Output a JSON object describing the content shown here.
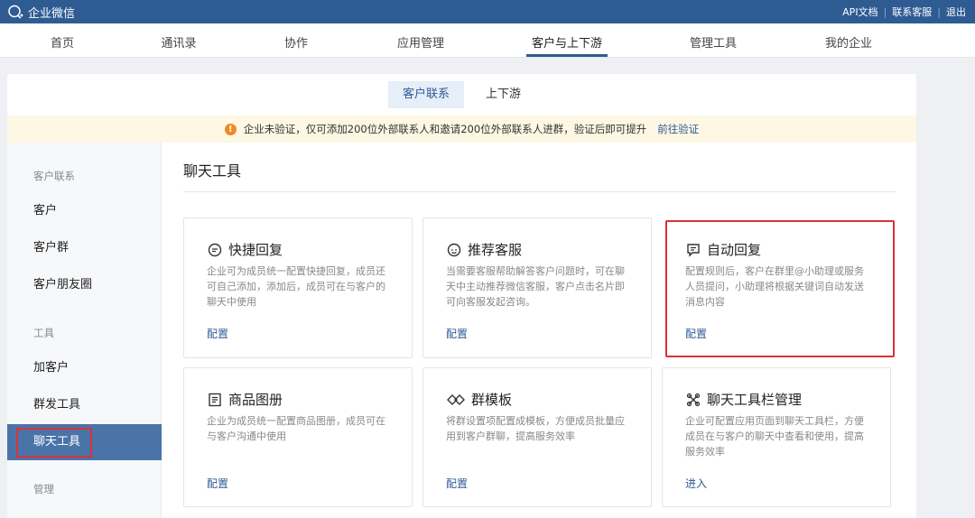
{
  "app": {
    "name": "企业微信"
  },
  "toplinks": {
    "api_docs": "API文档",
    "support": "联系客服",
    "logout": "退出",
    "separator": "|"
  },
  "mainnav": {
    "items": [
      "首页",
      "通讯录",
      "协作",
      "应用管理",
      "客户与上下游",
      "管理工具",
      "我的企业"
    ],
    "active": "客户与上下游"
  },
  "subtabs": {
    "items": [
      "客户联系",
      "上下游"
    ],
    "active": "客户联系"
  },
  "notice": {
    "text": "企业未验证，仅可添加200位外部联系人和邀请200位外部联系人进群，验证后即可提升",
    "link": "前往验证",
    "warn_icon": "!"
  },
  "sidebar": {
    "groups": [
      {
        "label": "客户联系",
        "items": [
          "客户",
          "客户群",
          "客户朋友圈"
        ]
      },
      {
        "label": "工具",
        "items": [
          "加客户",
          "群发工具",
          "聊天工具"
        ]
      },
      {
        "label": "管理",
        "items": []
      }
    ],
    "active": "聊天工具"
  },
  "content": {
    "title": "聊天工具",
    "cards": [
      {
        "title": "快捷回复",
        "icon": "quick-reply-icon",
        "desc": "企业可为成员统一配置快捷回复，成员还可自己添加，添加后，成员可在与客户的聊天中使用",
        "link": "配置"
      },
      {
        "title": "推荐客服",
        "icon": "recommend-service-icon",
        "desc": "当需要客服帮助解答客户问题时，可在聊天中主动推荐微信客服，客户点击名片即可向客服发起咨询。",
        "link": "配置"
      },
      {
        "title": "自动回复",
        "icon": "auto-reply-icon",
        "desc": "配置规则后，客户在群里@小助理或服务人员提问，小助理将根据关键词自动发送消息内容",
        "link": "配置"
      },
      {
        "title": "商品图册",
        "icon": "product-album-icon",
        "desc": "企业为成员统一配置商品图册，成员可在与客户沟通中使用",
        "link": "配置"
      },
      {
        "title": "群模板",
        "icon": "group-template-icon",
        "desc": "将群设置项配置成模板，方便成员批量应用到客户群聊，提高服务效率",
        "link": "配置"
      },
      {
        "title": "聊天工具栏管理",
        "icon": "toolbar-manage-icon",
        "desc": "企业可配置应用页面到聊天工具栏，方便成员在与客户的聊天中查看和使用，提高服务效率",
        "link": "进入"
      }
    ]
  },
  "colors": {
    "brand": "#2f5b93",
    "active_sidebar": "#4a74a8",
    "highlight": "#d9313a",
    "notice_bg": "#fdf7e3",
    "warn": "#f08a24"
  }
}
